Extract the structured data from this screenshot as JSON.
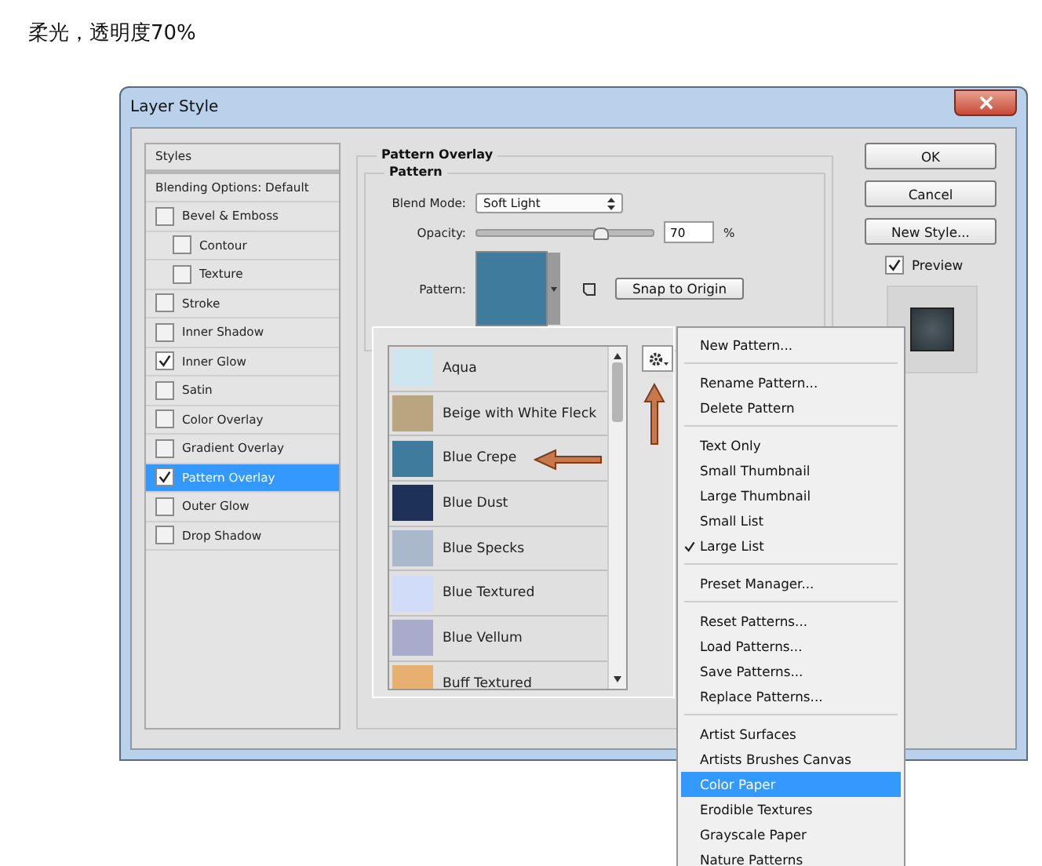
{
  "caption": "柔光，透明度70%",
  "window": {
    "title": "Layer Style"
  },
  "styles": [
    {
      "label": "Styles",
      "kind": "header",
      "selected": false
    },
    {
      "label": "Blending Options: Default",
      "kind": "option",
      "selected": false
    },
    {
      "label": "Bevel & Emboss",
      "kind": "check",
      "checked": false,
      "selected": false,
      "children": [
        {
          "label": "Contour",
          "kind": "check",
          "checked": false,
          "selected": false
        },
        {
          "label": "Texture",
          "kind": "check",
          "checked": false,
          "selected": false
        }
      ]
    },
    {
      "label": "Stroke",
      "kind": "check",
      "checked": false,
      "selected": false
    },
    {
      "label": "Inner Shadow",
      "kind": "check",
      "checked": false,
      "selected": false
    },
    {
      "label": "Inner Glow",
      "kind": "check",
      "checked": true,
      "selected": false
    },
    {
      "label": "Satin",
      "kind": "check",
      "checked": false,
      "selected": false
    },
    {
      "label": "Color Overlay",
      "kind": "check",
      "checked": false,
      "selected": false
    },
    {
      "label": "Gradient Overlay",
      "kind": "check",
      "checked": false,
      "selected": false
    },
    {
      "label": "Pattern Overlay",
      "kind": "check",
      "checked": true,
      "selected": true
    },
    {
      "label": "Outer Glow",
      "kind": "check",
      "checked": false,
      "selected": false
    },
    {
      "label": "Drop Shadow",
      "kind": "check",
      "checked": false,
      "selected": false
    }
  ],
  "panel": {
    "title": "Pattern Overlay",
    "group": "Pattern",
    "blend_mode": {
      "label": "Blend Mode:",
      "value": "Soft Light"
    },
    "opacity": {
      "label": "Opacity:",
      "level": 0.7,
      "value": "70",
      "unit": "%"
    },
    "pattern": {
      "label": "Pattern:",
      "color": "#3f7b9c"
    },
    "snap_button": "Snap to Origin"
  },
  "buttons": [
    "OK",
    "Cancel",
    "New Style..."
  ],
  "preview": {
    "label": "Preview",
    "checked": true
  },
  "patterns": [
    {
      "name": "Aqua",
      "color": "#cde6ef"
    },
    {
      "name": "Beige with White Fleck",
      "color": "#b9a680"
    },
    {
      "name": "Blue Crepe",
      "color": "#3f7b9c"
    },
    {
      "name": "Blue Dust",
      "color": "#1e3257"
    },
    {
      "name": "Blue Specks",
      "color": "#aab8cc"
    },
    {
      "name": "Blue Textured",
      "color": "#d0dcf8"
    },
    {
      "name": "Blue Vellum",
      "color": "#a8abcb"
    },
    {
      "name": "Buff Textured",
      "color": "#e8b070"
    }
  ],
  "menu": [
    [
      {
        "label": "New Pattern...",
        "checked": false,
        "selected": false
      }
    ],
    [
      {
        "label": "Rename Pattern...",
        "checked": false,
        "selected": false
      },
      {
        "label": "Delete Pattern",
        "checked": false,
        "selected": false
      }
    ],
    [
      {
        "label": "Text Only",
        "checked": false,
        "selected": false
      },
      {
        "label": "Small Thumbnail",
        "checked": false,
        "selected": false
      },
      {
        "label": "Large Thumbnail",
        "checked": false,
        "selected": false
      },
      {
        "label": "Small List",
        "checked": false,
        "selected": false
      },
      {
        "label": "Large List",
        "checked": true,
        "selected": false
      }
    ],
    [
      {
        "label": "Preset Manager...",
        "checked": false,
        "selected": false
      }
    ],
    [
      {
        "label": "Reset Patterns...",
        "checked": false,
        "selected": false
      },
      {
        "label": "Load Patterns...",
        "checked": false,
        "selected": false
      },
      {
        "label": "Save Patterns...",
        "checked": false,
        "selected": false
      },
      {
        "label": "Replace Patterns...",
        "checked": false,
        "selected": false
      }
    ],
    [
      {
        "label": "Artist Surfaces",
        "checked": false,
        "selected": false
      },
      {
        "label": "Artists Brushes Canvas",
        "checked": false,
        "selected": false
      },
      {
        "label": "Color Paper",
        "checked": false,
        "selected": true
      },
      {
        "label": "Erodible Textures",
        "checked": false,
        "selected": false
      },
      {
        "label": "Grayscale Paper",
        "checked": false,
        "selected": false
      },
      {
        "label": "Nature Patterns",
        "checked": false,
        "selected": false
      }
    ]
  ]
}
